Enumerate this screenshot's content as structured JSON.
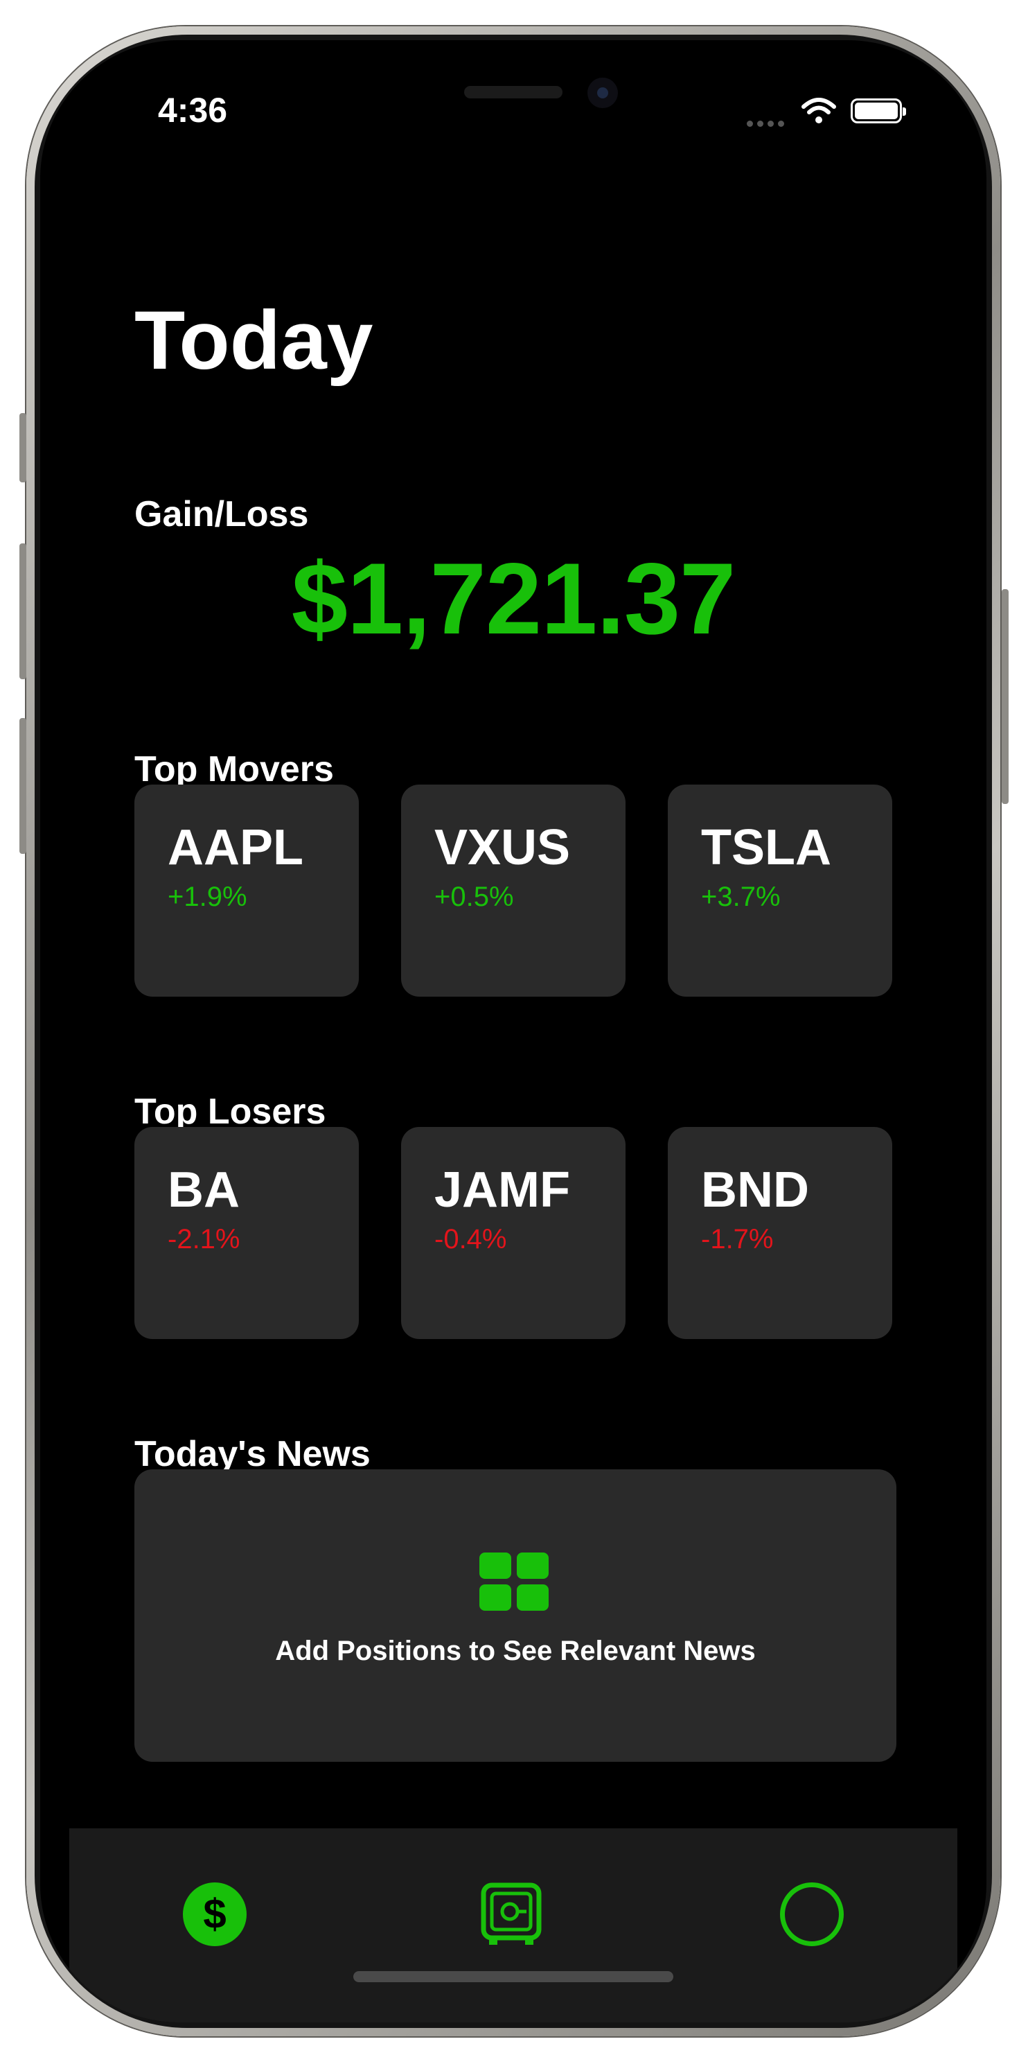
{
  "status_bar": {
    "time": "4:36"
  },
  "header": {
    "title": "Today"
  },
  "gain_loss": {
    "label": "Gain/Loss",
    "value": "$1,721.37"
  },
  "top_movers": {
    "label": "Top Movers",
    "items": [
      {
        "symbol": "AAPL",
        "change": "+1.9%"
      },
      {
        "symbol": "VXUS",
        "change": "+0.5%"
      },
      {
        "symbol": "TSLA",
        "change": "+3.7%"
      }
    ]
  },
  "top_losers": {
    "label": "Top Losers",
    "items": [
      {
        "symbol": "BA",
        "change": "-2.1%"
      },
      {
        "symbol": "JAMF",
        "change": "-0.4%"
      },
      {
        "symbol": "BND",
        "change": "-1.7%"
      }
    ]
  },
  "news": {
    "label": "Today's News",
    "icon": "grid-icon",
    "empty_message": "Add Positions to See Relevant News"
  },
  "tab_bar": {
    "tabs": [
      {
        "icon": "dollar-icon",
        "glyph": "$",
        "selected": true
      },
      {
        "icon": "safe-icon",
        "selected": false
      },
      {
        "icon": "circle-icon",
        "selected": false
      }
    ]
  },
  "colors": {
    "accent": "#18c00a",
    "negative": "#e3141b",
    "card": "#2a2a2a",
    "background": "#000000"
  }
}
